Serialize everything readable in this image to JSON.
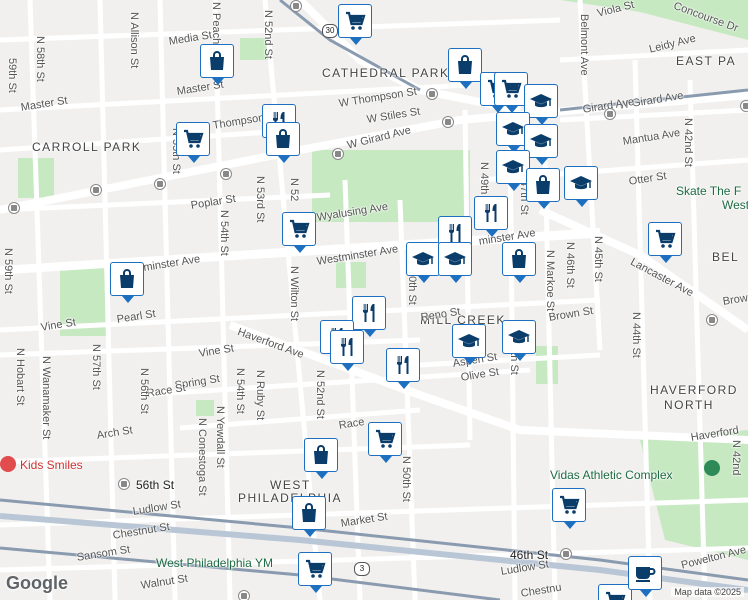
{
  "map": {
    "credit": "Map data ©2025",
    "logo": "Google",
    "colors": {
      "road": "#ffffff",
      "land": "#f1f0ee",
      "park": "#c7e9c2",
      "pin_border": "#1d6fbf",
      "pin_icon": "#0b3d6b",
      "rail": "#8a9bb0",
      "highway": "#b9c6d6"
    }
  },
  "labels": {
    "neighborhoods": {
      "cathedral_park": "CATHEDRAL PARK",
      "east_park": "EAST PA",
      "carroll_park": "CARROLL PARK",
      "mill_creek": "MILL CREEK",
      "haverford": "HAVERFORD",
      "north": "NORTH",
      "west": "WEST",
      "philadelphia": "PHILADELPHIA",
      "bel": "BEL"
    },
    "streets": {
      "media": "Media St",
      "master": "Master St",
      "w_thompson": "W Thompson St",
      "w_stiles": "W Stiles St",
      "w_girard": "W Girard Ave",
      "w_girard2": "Girard Ave",
      "w_girard_w": "W Girard Ave",
      "thompson": "Thompson St",
      "poplar": "Poplar St",
      "wyalusing": "Wyalusing Ave",
      "westminster_w": "Westminster Ave",
      "westminster_e": "Westminster Ave",
      "minster": "minster Ave",
      "pearl": "Pearl St",
      "vine": "Vine St",
      "vine2": "Vine St",
      "haverford_ave": "Haverford Ave",
      "haverford_e": "Haverford",
      "spring": "Spring St",
      "race": "Race St",
      "race2": "Race",
      "arch": "Arch St",
      "reno": "Reno St",
      "brown": "Brown St",
      "brown2": "Brow",
      "aspen": "Aspen St",
      "olive": "Olive St",
      "otter": "Otter St",
      "mantua": "Mantua Ave",
      "lancaster": "Lancaster Ave",
      "concourse": "Concourse Dr",
      "viola": "Viola St",
      "leidy": "Leidy Ave",
      "ludlow": "Ludlow St",
      "ludlow2": "Ludlow St",
      "market": "Market St",
      "chestnut": "Chestnut St",
      "chestnut2": "Chestnu",
      "sansom": "Sansom St",
      "walnut": "Walnut St",
      "powelton": "Powelton Ave",
      "n58": "N 58th St",
      "n57": "N 57th St",
      "n56": "N 56th St",
      "n55": "N 55th St",
      "n55b": "N 55th St",
      "n54": "N 54th St",
      "n54b": "N 54th St",
      "n53": "N 53rd St",
      "n52": "N 52nd St",
      "n52b": "N 52nd St",
      "n52c": "N 52",
      "n51": "N 51st",
      "n50": "N 50th St",
      "n50b": "50th St",
      "n49": "N 49th",
      "n48": "48th St",
      "n47": "47th St",
      "n46": "N 46th St",
      "n45": "N 45th St",
      "n44": "N 44th St",
      "n42": "N 42nd St",
      "n42b": "N 42nd",
      "n59": "N 59th St",
      "n59b": "59th St",
      "n58b": "N 58th",
      "allison": "N Allison St",
      "peach": "N Peach St",
      "wilton": "N Wilton St",
      "markoe": "N Markoe St",
      "hobart": "N Hobart St",
      "wanamaker": "N Wanamaker St",
      "conestoga": "N Conestoga St",
      "yewdall": "N Yewdall St",
      "ruby": "N Ruby St",
      "belmont": "Belmont Ave",
      "w_girard_e": "W Girard Ave"
    },
    "places": {
      "kids_smiles": "Kids Smiles",
      "vidas": "Vidas Athletic Complex",
      "skate": "Skate The F",
      "skate2": "West",
      "ymca": "West Philadelphia YM",
      "st56": "56th St",
      "st46": "46th St",
      "route30": "30",
      "route3": "3"
    }
  },
  "pins": [
    {
      "icon": "shopping-cart-icon"
    },
    {
      "icon": "shopping-bag-icon"
    },
    {
      "icon": "shopping-bag-icon"
    },
    {
      "icon": "shopping-cart-icon"
    },
    {
      "icon": "shopping-cart-icon"
    },
    {
      "icon": "graduation-cap-icon"
    },
    {
      "icon": "shopping-cart-icon"
    },
    {
      "icon": "restaurant-icon"
    },
    {
      "icon": "shopping-bag-icon"
    },
    {
      "icon": "graduation-cap-icon"
    },
    {
      "icon": "graduation-cap-icon"
    },
    {
      "icon": "graduation-cap-icon"
    },
    {
      "icon": "shopping-bag-icon"
    },
    {
      "icon": "graduation-cap-icon"
    },
    {
      "icon": "restaurant-icon"
    },
    {
      "icon": "restaurant-icon"
    },
    {
      "icon": "graduation-cap-icon"
    },
    {
      "icon": "graduation-cap-icon"
    },
    {
      "icon": "shopping-bag-icon"
    },
    {
      "icon": "shopping-cart-icon"
    },
    {
      "icon": "shopping-cart-icon"
    },
    {
      "icon": "shopping-bag-icon"
    },
    {
      "icon": "restaurant-icon"
    },
    {
      "icon": "restaurant-icon"
    },
    {
      "icon": "restaurant-icon"
    },
    {
      "icon": "restaurant-icon"
    },
    {
      "icon": "graduation-cap-icon"
    },
    {
      "icon": "graduation-cap-icon"
    },
    {
      "icon": "shopping-cart-icon"
    },
    {
      "icon": "shopping-bag-icon"
    },
    {
      "icon": "shopping-cart-icon"
    },
    {
      "icon": "shopping-bag-icon"
    },
    {
      "icon": "shopping-cart-icon"
    },
    {
      "icon": "shopping-cart-icon"
    },
    {
      "icon": "coffee-icon"
    }
  ]
}
